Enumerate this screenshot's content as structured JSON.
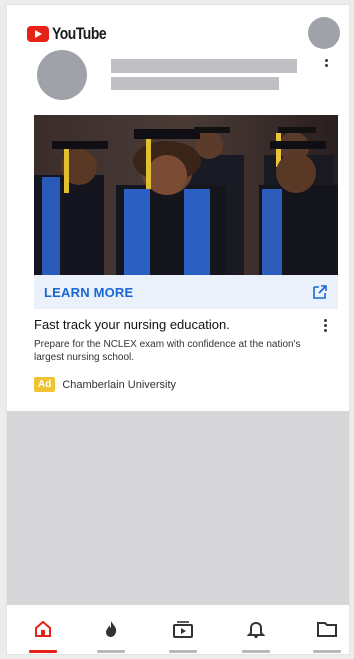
{
  "app": {
    "brand": "YouTube",
    "brand_color": "#e62117"
  },
  "ad": {
    "cta_label": "LEARN MORE",
    "cta_color": "#1a67d2",
    "title": "Fast track your nursing education.",
    "description": "Prepare for the NCLEX exam with confidence at the nation's largest nursing school.",
    "badge": "Ad",
    "badge_color": "#f1c232",
    "advertiser": "Chamberlain University"
  },
  "bottom_nav": {
    "items": [
      {
        "icon": "home-icon",
        "active": true
      },
      {
        "icon": "trending-flame-icon",
        "active": false
      },
      {
        "icon": "subscriptions-icon",
        "active": false
      },
      {
        "icon": "bell-icon",
        "active": false
      },
      {
        "icon": "library-folder-icon",
        "active": false
      }
    ]
  }
}
